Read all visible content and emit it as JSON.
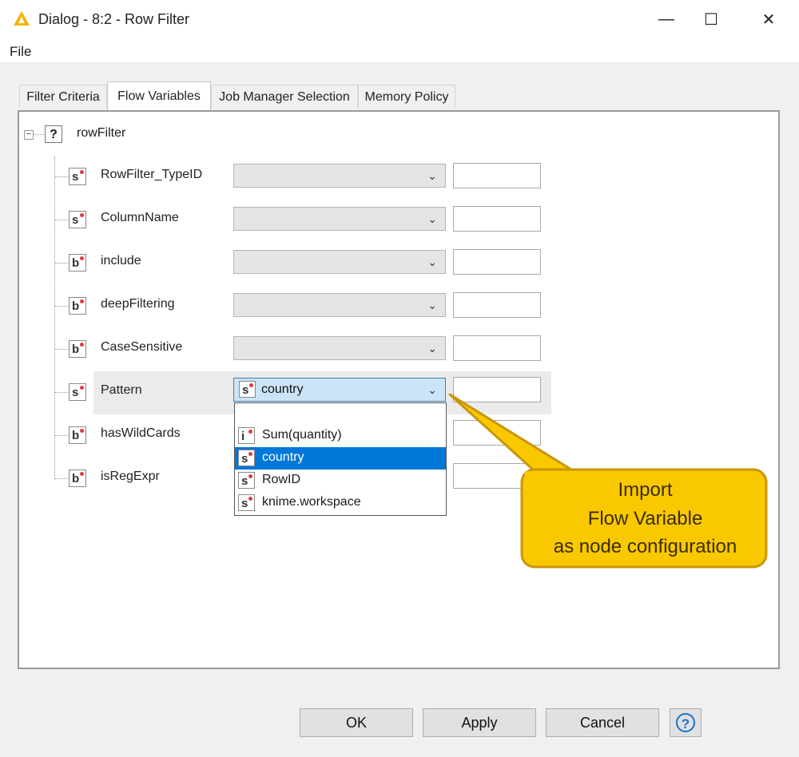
{
  "window": {
    "title": "Dialog - 8:2 - Row Filter",
    "minimize": "—",
    "maximize": "☐",
    "close": "✕"
  },
  "menu": {
    "file": "File"
  },
  "tabs": [
    {
      "label": "Filter Criteria",
      "active": false
    },
    {
      "label": "Flow Variables",
      "active": true
    },
    {
      "label": "Job Manager Selection",
      "active": false
    },
    {
      "label": "Memory Policy",
      "active": false
    }
  ],
  "tree": {
    "root": {
      "label": "rowFilter",
      "icon": "?",
      "expander": "⊟"
    },
    "rows": [
      {
        "label": "RowFilter_TypeID",
        "type": "s",
        "selected": ""
      },
      {
        "label": "ColumnName",
        "type": "s",
        "selected": ""
      },
      {
        "label": "include",
        "type": "b",
        "selected": ""
      },
      {
        "label": "deepFiltering",
        "type": "b",
        "selected": ""
      },
      {
        "label": "CaseSensitive",
        "type": "b",
        "selected": ""
      },
      {
        "label": "Pattern",
        "type": "s",
        "selected": "country"
      },
      {
        "label": "hasWildCards",
        "type": "b",
        "selected": ""
      },
      {
        "label": "isRegExpr",
        "type": "b",
        "selected": ""
      }
    ]
  },
  "dropdown": {
    "options": [
      {
        "label": "",
        "type": ""
      },
      {
        "label": "Sum(quantity)",
        "type": "i"
      },
      {
        "label": "country",
        "type": "s",
        "selected": true
      },
      {
        "label": "RowID",
        "type": "s"
      },
      {
        "label": "knime.workspace",
        "type": "s"
      }
    ]
  },
  "callout": {
    "line1": "Import",
    "line2": "Flow Variable",
    "line3": "as node configuration",
    "fill": "#f9c800",
    "stroke": "#c8960a"
  },
  "buttons": {
    "ok": "OK",
    "apply": "Apply",
    "cancel": "Cancel",
    "help": "?"
  },
  "colors": {
    "accent": "#0078d7",
    "variable_dot": "#e23b3b"
  }
}
